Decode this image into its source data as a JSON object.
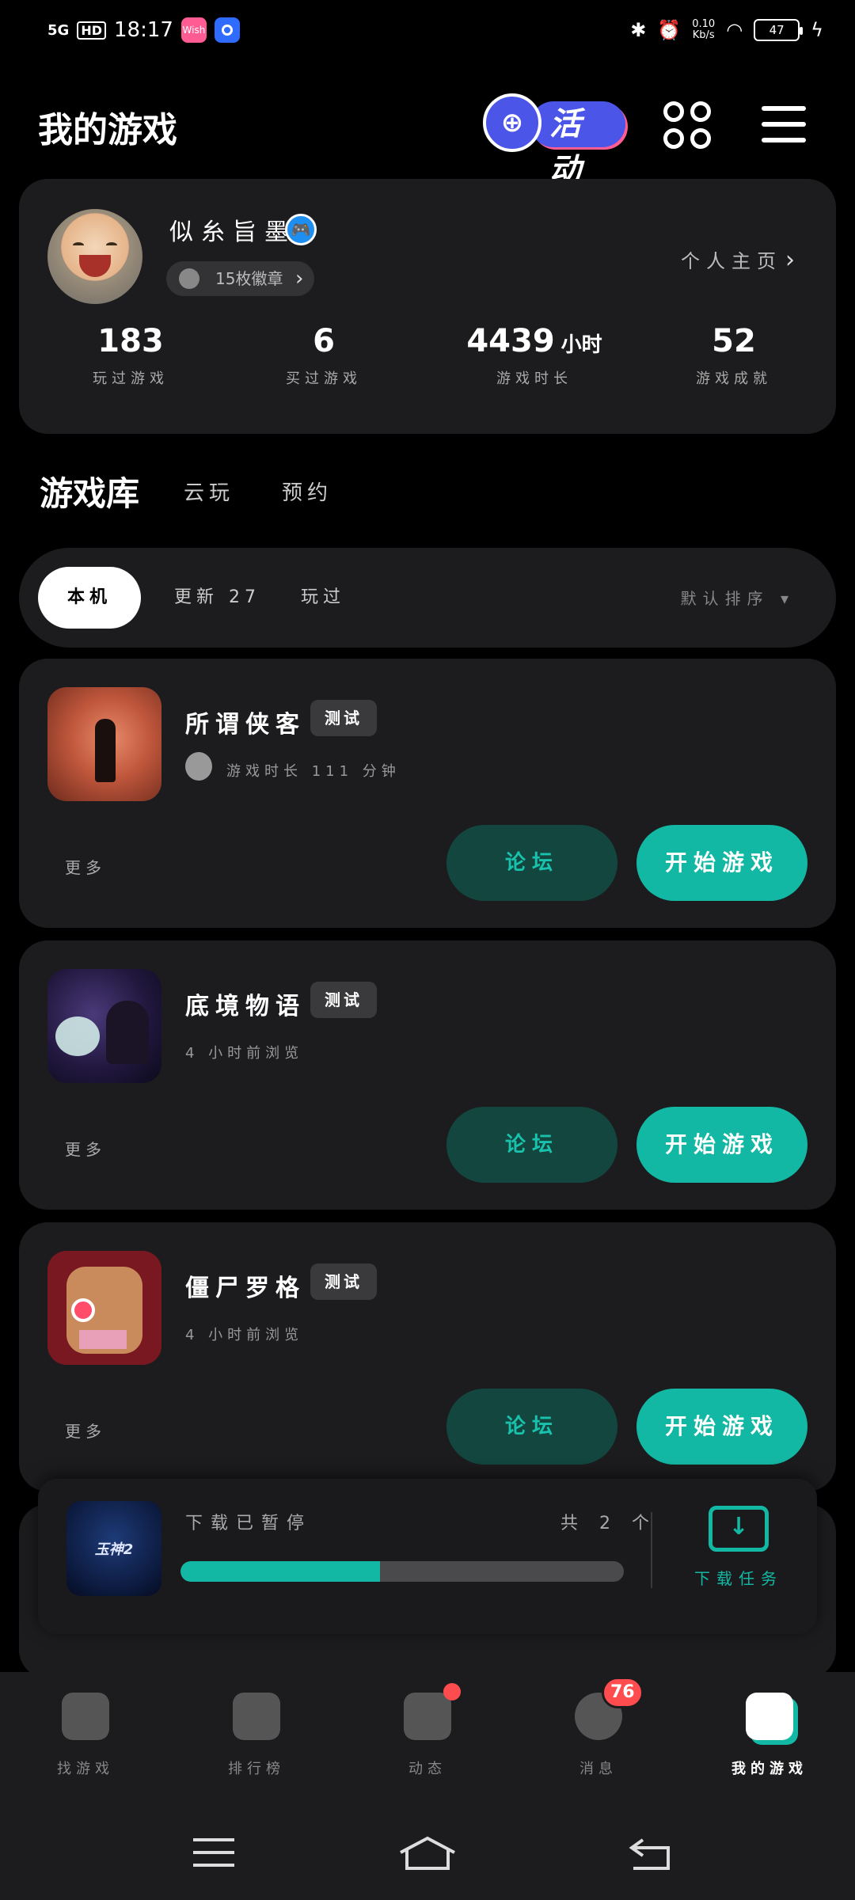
{
  "status_bar": {
    "network": "5G",
    "hd": "HD",
    "time": "18:17",
    "app1": "Wish",
    "speed_value": "0.10",
    "speed_unit": "Kb/s",
    "battery": "47"
  },
  "header": {
    "title": "我的游戏",
    "activity_label": "活动"
  },
  "profile": {
    "username": "似糸旨墨",
    "badges_label": "15枚徽章",
    "homepage_label": "个人主页",
    "stats": [
      {
        "value": "183",
        "unit": "",
        "label": "玩过游戏"
      },
      {
        "value": "6",
        "unit": "",
        "label": "买过游戏"
      },
      {
        "value": "4439",
        "unit": "小时",
        "label": "游戏时长"
      },
      {
        "value": "52",
        "unit": "",
        "label": "游戏成就"
      }
    ]
  },
  "library_tabs": [
    "游戏库",
    "云玩",
    "预约"
  ],
  "filters": {
    "chips": [
      "本机",
      "更新 27",
      "玩过"
    ],
    "sort_label": "默认排序"
  },
  "games": [
    {
      "name": "所谓侠客",
      "tag": "测试",
      "subtitle": "游戏时长 111 分钟",
      "more": "更多",
      "forum": "论坛",
      "start": "开始游戏"
    },
    {
      "name": "底境物语",
      "tag": "测试",
      "subtitle": "4 小时前浏览",
      "more": "更多",
      "forum": "论坛",
      "start": "开始游戏"
    },
    {
      "name": "僵尸罗格",
      "tag": "测试",
      "subtitle": "4 小时前浏览",
      "more": "更多",
      "forum": "论坛",
      "start": "开始游戏"
    }
  ],
  "download": {
    "thumb_text": "玉神2",
    "status": "下载已暂停",
    "count": "共 2 个",
    "progress": 0.45,
    "task_label": "下载任务"
  },
  "bottom_nav": [
    {
      "label": "找游戏",
      "icon": "find-game-icon"
    },
    {
      "label": "排行榜",
      "icon": "ranking-icon"
    },
    {
      "label": "动态",
      "icon": "feed-icon"
    },
    {
      "label": "消息",
      "icon": "message-icon",
      "badge": "76"
    },
    {
      "label": "我的游戏",
      "icon": "my-games-icon"
    }
  ],
  "colors": {
    "accent": "#13b8a4",
    "background": "#000000",
    "card": "#1c1c1e",
    "badge_red": "#ff4d4f",
    "activity_blue": "#4b55e8"
  }
}
